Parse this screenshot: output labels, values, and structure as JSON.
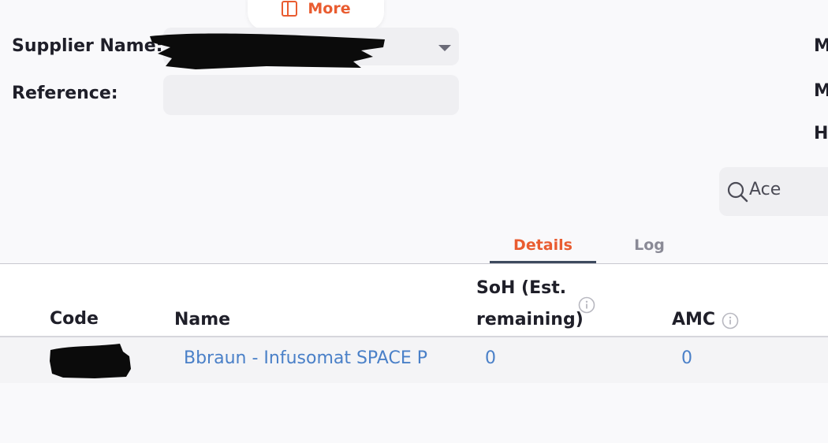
{
  "toolbar": {
    "more_label": "More",
    "more_icon": "book-icon"
  },
  "form": {
    "supplier_label": "Supplier Name:",
    "supplier_value": "",
    "reference_label": "Reference:",
    "reference_value": ""
  },
  "right_edge_labels": [
    "M",
    "M",
    "H"
  ],
  "search": {
    "value": "Ace",
    "icon": "search-icon"
  },
  "tabs": [
    {
      "label": "Details",
      "active": true
    },
    {
      "label": "Log",
      "active": false
    }
  ],
  "table": {
    "columns": [
      {
        "label": "Code"
      },
      {
        "label": "Name"
      },
      {
        "label": "SoH (Est. remaining)",
        "line1": "SoH (Est.",
        "line2": "remaining)",
        "info": true
      },
      {
        "label": "AMC",
        "info": true
      }
    ],
    "rows": [
      {
        "code": "",
        "name": "Bbraun - Infusomat SPACE P",
        "soh": "0",
        "amc": "0"
      }
    ]
  },
  "colors": {
    "accent": "#e95c30",
    "link": "#4a80c8",
    "tab_underline": "#3e4a5e",
    "field_bg": "#efeff2"
  }
}
